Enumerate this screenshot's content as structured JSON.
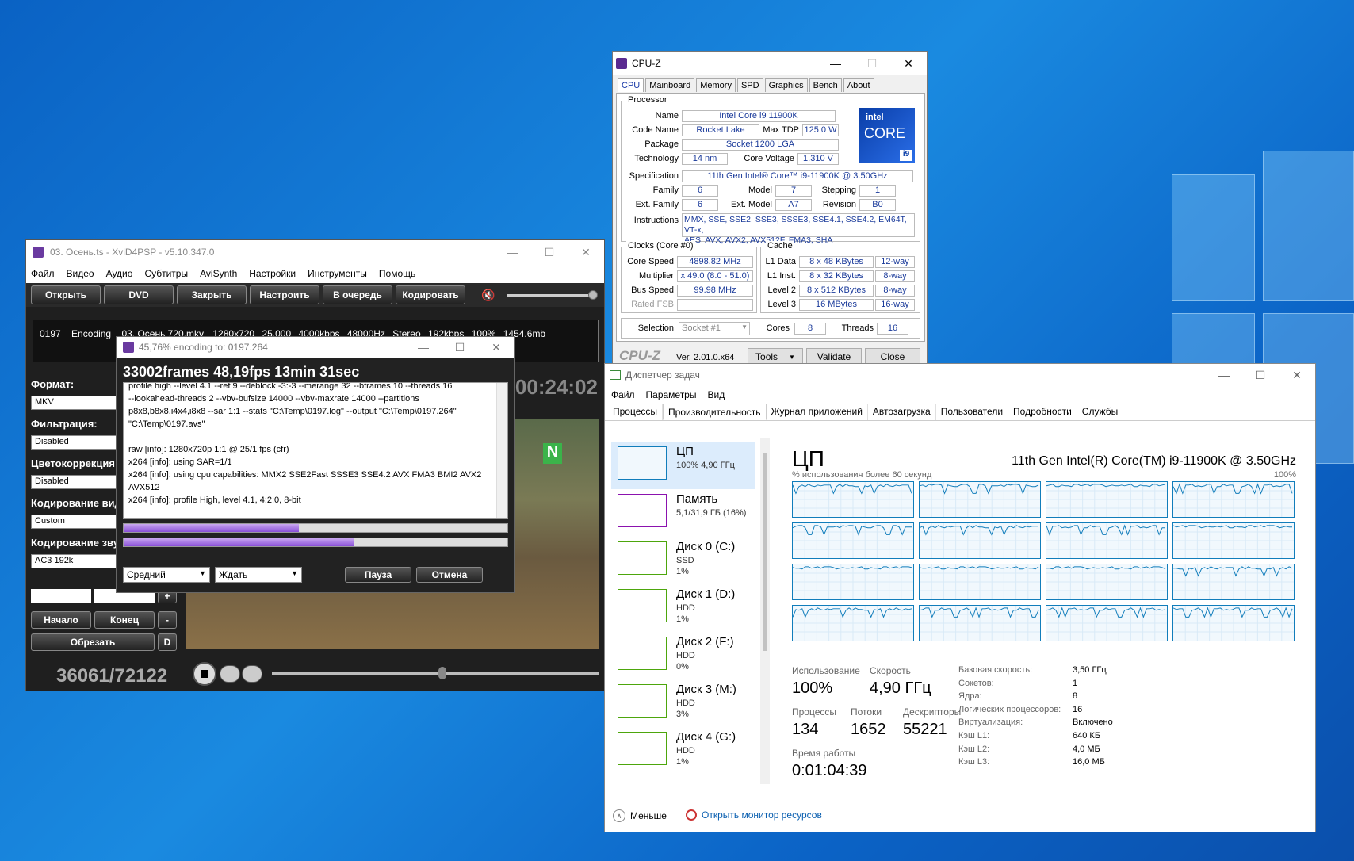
{
  "xvid": {
    "title": "03. Осень.ts - XviD4PSP - v5.10.347.0",
    "menu": [
      "Файл",
      "Видео",
      "Аудио",
      "Субтитры",
      "AviSynth",
      "Настройки",
      "Инструменты",
      "Помощь"
    ],
    "buttons": [
      "Открыть",
      "DVD",
      "Закрыть",
      "Настроить",
      "В очередь",
      "Кодировать"
    ],
    "queue": {
      "id": "0197",
      "status": "Encoding",
      "file": "03. Осень 720.mkv",
      "res": "1280x720",
      "fps": "25.000",
      "vbitrate": "4000kbps",
      "arate": "48000Hz",
      "ch": "Stereo",
      "abitrate": "192kbps",
      "pct": "100%",
      "size": "1454.6mb"
    },
    "labels": {
      "format": "Формат:",
      "filter": "Фильтрация:",
      "color": "Цветокоррекция",
      "vcodec": "Кодирование вид",
      "acodec": "Кодирование зву"
    },
    "values": {
      "format": "MKV",
      "filter": "Disabled",
      "color": "Disabled",
      "vcodec": "Custom",
      "acodec": "AC3 192k"
    },
    "nav": {
      "start": "Начало",
      "end": "Конец",
      "cut": "Обрезать",
      "plus": "+",
      "minus": "-",
      "d": "D"
    },
    "time": "00:24:02",
    "counter": "36061/72122"
  },
  "encoding": {
    "title": "45,76% encoding to: 0197.264",
    "stats": "33002frames 48,19fps 13min 31sec",
    "log": [
      "profile high --level 4.1 --ref 9 --deblock -3:-3 --merange 32 --bframes 10 --threads 16",
      "--lookahead-threads 2 --vbv-bufsize 14000 --vbv-maxrate 14000 --partitions",
      "p8x8,b8x8,i4x4,i8x8 --sar 1:1 --stats \"C:\\Temp\\0197.log\" --output \"C:\\Temp\\0197.264\"",
      "\"C:\\Temp\\0197.avs\"",
      "",
      "raw [info]: 1280x720p 1:1 @ 25/1 fps (cfr)",
      "x264 [info]: using SAR=1/1",
      "x264 [info]: using cpu capabilities: MMX2 SSE2Fast SSSE3 SSE4.2 AVX FMA3 BMI2 AVX2",
      "AVX512",
      "x264 [info]: profile High, level 4.1, 4:2:0, 8-bit"
    ],
    "progress1": 0.4576,
    "progress2": 0.6,
    "priority": "Средний",
    "action": "Ждать",
    "pause": "Пауза",
    "cancel": "Отмена"
  },
  "cpuz": {
    "title": "CPU-Z",
    "tabs": [
      "CPU",
      "Mainboard",
      "Memory",
      "SPD",
      "Graphics",
      "Bench",
      "About"
    ],
    "processor_label": "Processor",
    "name_l": "Name",
    "name": "Intel Core i9 11900K",
    "code_l": "Code Name",
    "code": "Rocket Lake",
    "tdp_l": "Max TDP",
    "tdp": "125.0 W",
    "pkg_l": "Package",
    "pkg": "Socket 1200 LGA",
    "tech_l": "Technology",
    "tech": "14 nm",
    "volt_l": "Core Voltage",
    "volt": "1.310 V",
    "spec_l": "Specification",
    "spec": "11th Gen Intel® Core™ i9-11900K @ 3.50GHz",
    "fam_l": "Family",
    "fam": "6",
    "model_l": "Model",
    "model": "7",
    "step_l": "Stepping",
    "step": "1",
    "efam_l": "Ext. Family",
    "efam": "6",
    "emodel_l": "Ext. Model",
    "emodel": "A7",
    "rev_l": "Revision",
    "rev": "B0",
    "instr_l": "Instructions",
    "instr1": "MMX, SSE, SSE2, SSE3, SSSE3, SSE4.1, SSE4.2, EM64T, VT-x,",
    "instr2": "AES, AVX, AVX2, AVX512F, FMA3, SHA",
    "clocks_label": "Clocks (Core #0)",
    "cs_l": "Core Speed",
    "cs": "4898.82 MHz",
    "mul_l": "Multiplier",
    "mul": "x 49.0 (8.0 - 51.0)",
    "bus_l": "Bus Speed",
    "bus": "99.98 MHz",
    "fsb_l": "Rated FSB",
    "cache_label": "Cache",
    "l1d_l": "L1 Data",
    "l1d": "8 x 48 KBytes",
    "l1d_w": "12-way",
    "l1i_l": "L1 Inst.",
    "l1i": "8 x 32 KBytes",
    "l1i_w": "8-way",
    "l2_l": "Level 2",
    "l2": "8 x 512 KBytes",
    "l2_w": "8-way",
    "l3_l": "Level 3",
    "l3": "16 MBytes",
    "l3_w": "16-way",
    "sel_l": "Selection",
    "sel": "Socket #1",
    "cores_l": "Cores",
    "cores": "8",
    "threads_l": "Threads",
    "threads": "16",
    "brand": "CPU-Z",
    "ver": "Ver. 2.01.0.x64",
    "tools": "Tools",
    "validate": "Validate",
    "close": "Close",
    "logo_intel": "intel",
    "logo_core": "CORE",
    "logo_i9": "i9"
  },
  "tm": {
    "title": "Диспетчер задач",
    "menu": [
      "Файл",
      "Параметры",
      "Вид"
    ],
    "tabs": [
      "Процессы",
      "Производительность",
      "Журнал приложений",
      "Автозагрузка",
      "Пользователи",
      "Подробности",
      "Службы"
    ],
    "side": [
      {
        "t": "ЦП",
        "s1": "100% 4,90 ГГц",
        "s2": ""
      },
      {
        "t": "Память",
        "s1": "5,1/31,9 ГБ (16%)",
        "s2": ""
      },
      {
        "t": "Диск 0 (C:)",
        "s1": "SSD",
        "s2": "1%"
      },
      {
        "t": "Диск 1 (D:)",
        "s1": "HDD",
        "s2": "1%"
      },
      {
        "t": "Диск 2 (F:)",
        "s1": "HDD",
        "s2": "0%"
      },
      {
        "t": "Диск 3 (M:)",
        "s1": "HDD",
        "s2": "3%"
      },
      {
        "t": "Диск 4 (G:)",
        "s1": "HDD",
        "s2": "1%"
      }
    ],
    "head": "ЦП",
    "cpuname": "11th Gen Intel(R) Core(TM) i9-11900K @ 3.50GHz",
    "graph_label": "% использования более 60 секунд",
    "graph_max": "100%",
    "stats": {
      "util_l": "Использование",
      "util": "100%",
      "speed_l": "Скорость",
      "speed": "4,90 ГГц",
      "proc_l": "Процессы",
      "proc": "134",
      "thr_l": "Потоки",
      "thr": "1652",
      "hnd_l": "Дескрипторы",
      "hnd": "55221",
      "up_l": "Время работы",
      "up": "0:01:04:39"
    },
    "details": [
      [
        "Базовая скорость:",
        "3,50 ГГц"
      ],
      [
        "Сокетов:",
        "1"
      ],
      [
        "Ядра:",
        "8"
      ],
      [
        "Логических процессоров:",
        "16"
      ],
      [
        "Виртуализация:",
        "Включено"
      ],
      [
        "Кэш L1:",
        "640 КБ"
      ],
      [
        "Кэш L2:",
        "4,0 МБ"
      ],
      [
        "Кэш L3:",
        "16,0 МБ"
      ]
    ],
    "less": "Меньше",
    "monitor": "Открыть монитор ресурсов"
  }
}
